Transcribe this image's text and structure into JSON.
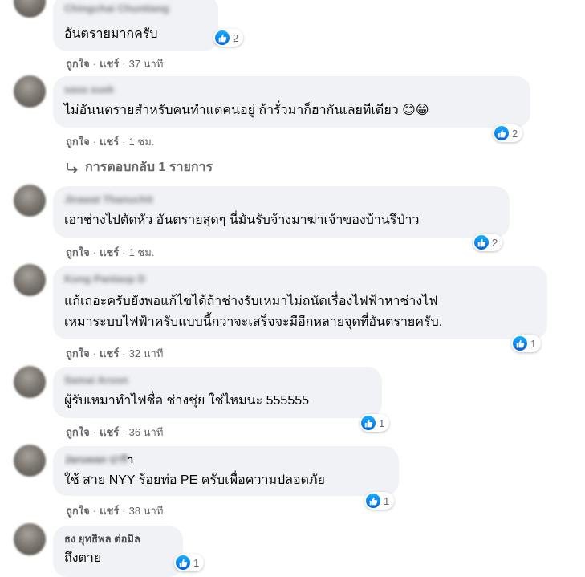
{
  "actions": {
    "like": "ถูกใจ",
    "share": "แชร์",
    "separator": "·"
  },
  "comments": [
    {
      "author": "Chingchai Chuntiang",
      "text": "อันตรายมากครับ",
      "time": "37 นาที",
      "reactions": "2"
    },
    {
      "author": "sasa suek",
      "text": "ไม่อันนตรายสำหรับคนทำแต่คนอยู่ ถ้ารั่วมาก็ฮากันเลยทีเดียว ",
      "emojis": [
        "😊",
        "😁"
      ],
      "time": "1 ชม.",
      "reactions": "2",
      "replies_label": "การตอบกลับ 1 รายการ"
    },
    {
      "author": "Jirawat Thanuchit",
      "text": "เอาช่างไปตัดหัว อันตรายสุดๆ นี่มันรับจ้างมาฆ่าเจ้าของบ้านรึป่าว",
      "time": "1 ชม.",
      "reactions": "2"
    },
    {
      "author": "Kong Pantaop D",
      "text": "แก้เถอะครับยังพอแก้ไขได้ถ้าช่างรับเหมาไม่ถนัดเรื่องไฟฟ้าหาช่างไฟ\nเหมาระบบไฟฟ้าครับแบบนี้กว่าจะเสร็จจะมีอีกหลายจุดที่อันตรายครับ.",
      "time": "32 นาที",
      "reactions": "1"
    },
    {
      "author": "Samai Aroon",
      "text": "ผู้รับเหมาทำไฟชื่อ ช่างชุ่ย ใช่ไหมนะ 555555",
      "time": "36 นาที",
      "reactions": "1"
    },
    {
      "author_hidden": "Jaruwan ปาริ",
      "author_visible": "า",
      "text": "ใช้ สาย NYY ร้อยท่อ PE ครับเพื่อความปลอดภัย",
      "time": "38 นาที",
      "reactions": "1"
    },
    {
      "author": "ธง ยุทธิพล ต่อมิล",
      "text": "ถึงตาย",
      "reactions": "1"
    }
  ]
}
